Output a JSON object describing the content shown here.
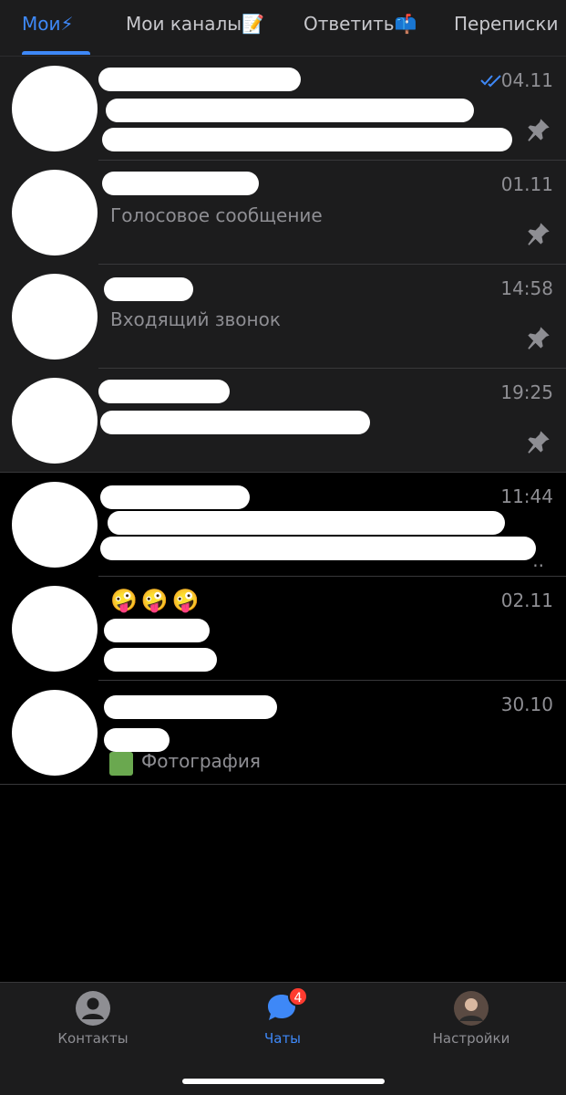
{
  "folders": [
    {
      "label": "Мои⚡"
    },
    {
      "label": "Мои каналы📝"
    },
    {
      "label": "Ответить📫"
    },
    {
      "label": "Переписки"
    }
  ],
  "chats": [
    {
      "time": "04.11",
      "preview": "",
      "pinned": true,
      "read_checks": true
    },
    {
      "time": "01.11",
      "preview": "Голосовое сообщение",
      "pinned": true
    },
    {
      "time": "14:58",
      "preview": "Входящий звонок",
      "pinned": true
    },
    {
      "time": "19:25",
      "preview": "",
      "pinned": true
    },
    {
      "time": "11:44",
      "preview": "",
      "pinned": false
    },
    {
      "time": "02.11",
      "preview": "",
      "emoji": "🤪🤪🤪",
      "pinned": false
    },
    {
      "time": "30.10",
      "preview": "Фотография",
      "pinned": false
    }
  ],
  "tabbar": {
    "contacts": "Контакты",
    "chats": "Чаты",
    "chats_badge": "4",
    "settings": "Настройки"
  },
  "colors": {
    "accent": "#3e88f7",
    "badge": "#ff3b30",
    "pinned_bg": "#1c1c1d"
  }
}
